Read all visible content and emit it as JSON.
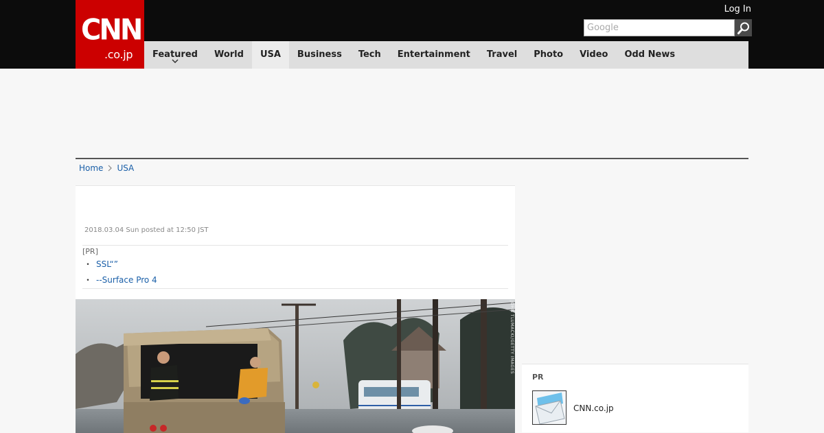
{
  "header": {
    "logo_main": "CNN",
    "logo_sub": ".co.jp",
    "login_label": "Log In",
    "search_placeholder": "Google"
  },
  "nav": {
    "items": [
      {
        "label": "Featured",
        "has_dropdown": true
      },
      {
        "label": "World"
      },
      {
        "label": "USA",
        "active": true
      },
      {
        "label": "Business"
      },
      {
        "label": "Tech"
      },
      {
        "label": "Entertainment"
      },
      {
        "label": "Travel"
      },
      {
        "label": "Photo"
      },
      {
        "label": "Video"
      },
      {
        "label": "Odd News"
      }
    ]
  },
  "breadcrumb": {
    "home": "Home",
    "current": "USA"
  },
  "article": {
    "date": "2018.03.04 Sun posted at 12:50 JST",
    "pr_tag": "[PR]",
    "pr_links": [
      {
        "bullet": "・",
        "text": "SSL“”"
      },
      {
        "bullet": "・",
        "text": "--Surface Pro 4"
      }
    ],
    "photo_credit": "JOHN TLUMACKI/GETTY IMAGES"
  },
  "sidebar": {
    "pr_title": "PR",
    "pr_item_label": "CNN.co.jp",
    "pr_item_icon": "mail-envelope-icon"
  },
  "colors": {
    "brand_red": "#cc0000",
    "header_bg": "#0c0c0c",
    "nav_bg": "#dedede",
    "link_blue": "#1a5fa8"
  }
}
